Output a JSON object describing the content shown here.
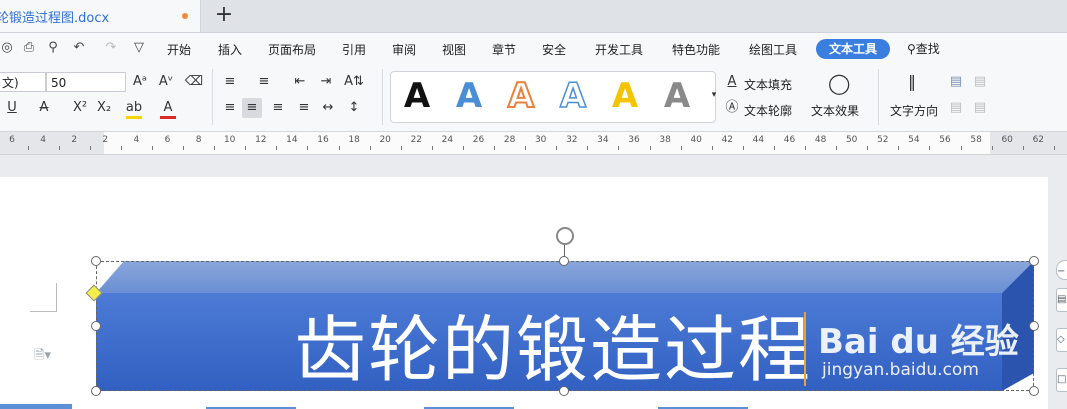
{
  "tab": {
    "title": "轮锻造过程图.docx",
    "new_tab": "+"
  },
  "quick_access": {
    "icons": [
      "print-preview-icon",
      "print-icon",
      "search-doc-icon",
      "undo-icon",
      "redo-icon",
      "customize-icon"
    ]
  },
  "menu": {
    "items": [
      "开始",
      "插入",
      "页面布局",
      "引用",
      "审阅",
      "视图",
      "章节",
      "安全",
      "开发工具",
      "特色功能",
      "绘图工具"
    ],
    "active": "文本工具",
    "search": "查找"
  },
  "ribbon": {
    "font_name": "文)",
    "font_size": "50",
    "text_fill": "文本填充",
    "text_outline": "文本轮廓",
    "text_effects": "文本效果",
    "text_direction": "文字方向",
    "art_samples": [
      {
        "letter": "A",
        "style": "black"
      },
      {
        "letter": "A",
        "style": "blue"
      },
      {
        "letter": "A",
        "style": "orange-outline"
      },
      {
        "letter": "A",
        "style": "blue-outline"
      },
      {
        "letter": "A",
        "style": "yellow"
      },
      {
        "letter": "A",
        "style": "gray"
      }
    ],
    "colors": {
      "accent": "#3a7ee0",
      "font_color_bar": "#d92a2a",
      "highlight_bar": "#f5d400"
    }
  },
  "ruler": {
    "labels": [
      "6",
      "4",
      "2",
      "2",
      "4",
      "6",
      "8",
      "10",
      "12",
      "14",
      "16",
      "18",
      "20",
      "22",
      "24",
      "26",
      "28",
      "30",
      "32",
      "34",
      "36",
      "38",
      "40",
      "42",
      "44",
      "46",
      "48",
      "50",
      "52",
      "54",
      "56",
      "58",
      "60",
      "62"
    ]
  },
  "document": {
    "title_text": "齿轮的锻造过程",
    "shape_colors": {
      "top": "#7a9ad6",
      "front": "#3f6fcf",
      "side": "#2f5cb8"
    }
  },
  "watermark": {
    "brand": "Bai du 经验",
    "url": "jingyan.baidu.com"
  }
}
